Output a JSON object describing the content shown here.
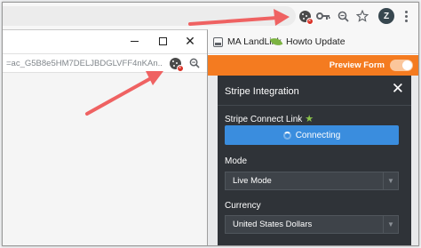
{
  "browser": {
    "avatar_letter": "Z",
    "icons": [
      "cookie-blocked-icon",
      "key-icon",
      "zoom-icon",
      "star-icon",
      "menu-icon"
    ]
  },
  "bookmarks": [
    {
      "label": "MA LandLink",
      "icon": "ma-landlink-icon"
    },
    {
      "label": "Howto Update",
      "icon": "leaf-icon"
    }
  ],
  "header": {
    "preview_label": "Preview Form"
  },
  "popup": {
    "url": "=ac_G5B8e5HM7DELJBDGLVFF4nKAn..."
  },
  "panel": {
    "title": "Stripe Integration",
    "connect_label": "Stripe Connect Link",
    "connect_button": "Connecting",
    "mode_label": "Mode",
    "mode_value": "Live Mode",
    "currency_label": "Currency",
    "currency_value": "United States Dollars"
  },
  "colors": {
    "orange": "#f47b20",
    "panel_bg": "#2f3338",
    "button_blue": "#3a8dde",
    "arrow": "#ef6262"
  }
}
